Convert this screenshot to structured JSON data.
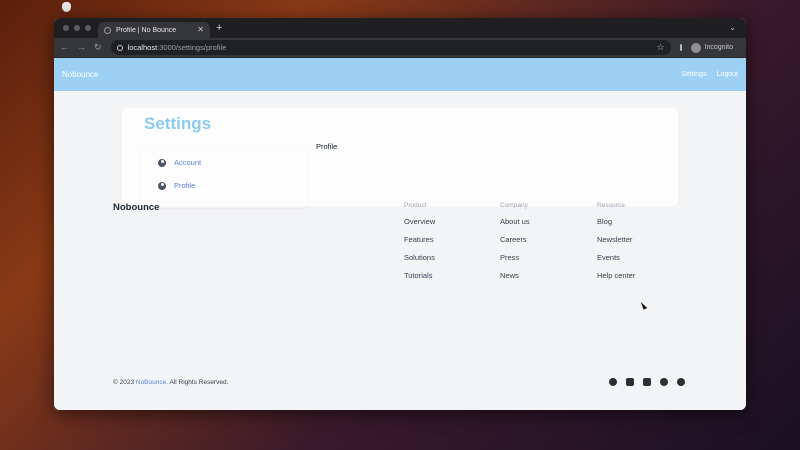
{
  "browser": {
    "tab_title": "Profile | No Bounce",
    "url_host": "localhost",
    "url_path": ":3000/settings/profile",
    "profile_label": "Incognito"
  },
  "app": {
    "brand": "Nobounce",
    "nav": [
      "Settings",
      "Logout"
    ]
  },
  "settings": {
    "title": "Settings",
    "menu": [
      {
        "label": "Account",
        "icon": "user-circle-icon"
      },
      {
        "label": "Profile",
        "icon": "user-circle-icon"
      }
    ],
    "panel_heading": "Profile"
  },
  "footer": {
    "brand": "Nobounce",
    "columns": [
      {
        "heading": "Product",
        "links": [
          "Overview",
          "Features",
          "Solutions",
          "Tutorials"
        ]
      },
      {
        "heading": "Company",
        "links": [
          "About us",
          "Careers",
          "Press",
          "News"
        ]
      },
      {
        "heading": "Resource",
        "links": [
          "Blog",
          "Newsletter",
          "Events",
          "Help center"
        ]
      }
    ],
    "copyright_prefix": "© 2023",
    "copyright_brand": "NoBounce.",
    "copyright_suffix": "All Rights Reserved.",
    "socials": [
      "facebook-icon",
      "instagram-icon",
      "twitter-icon",
      "github-icon",
      "dribbble-icon"
    ]
  },
  "colors": {
    "nav_bg": "#9cd1f5",
    "title_accent": "#8ccbf0",
    "link_accent": "#5a7fd8"
  }
}
